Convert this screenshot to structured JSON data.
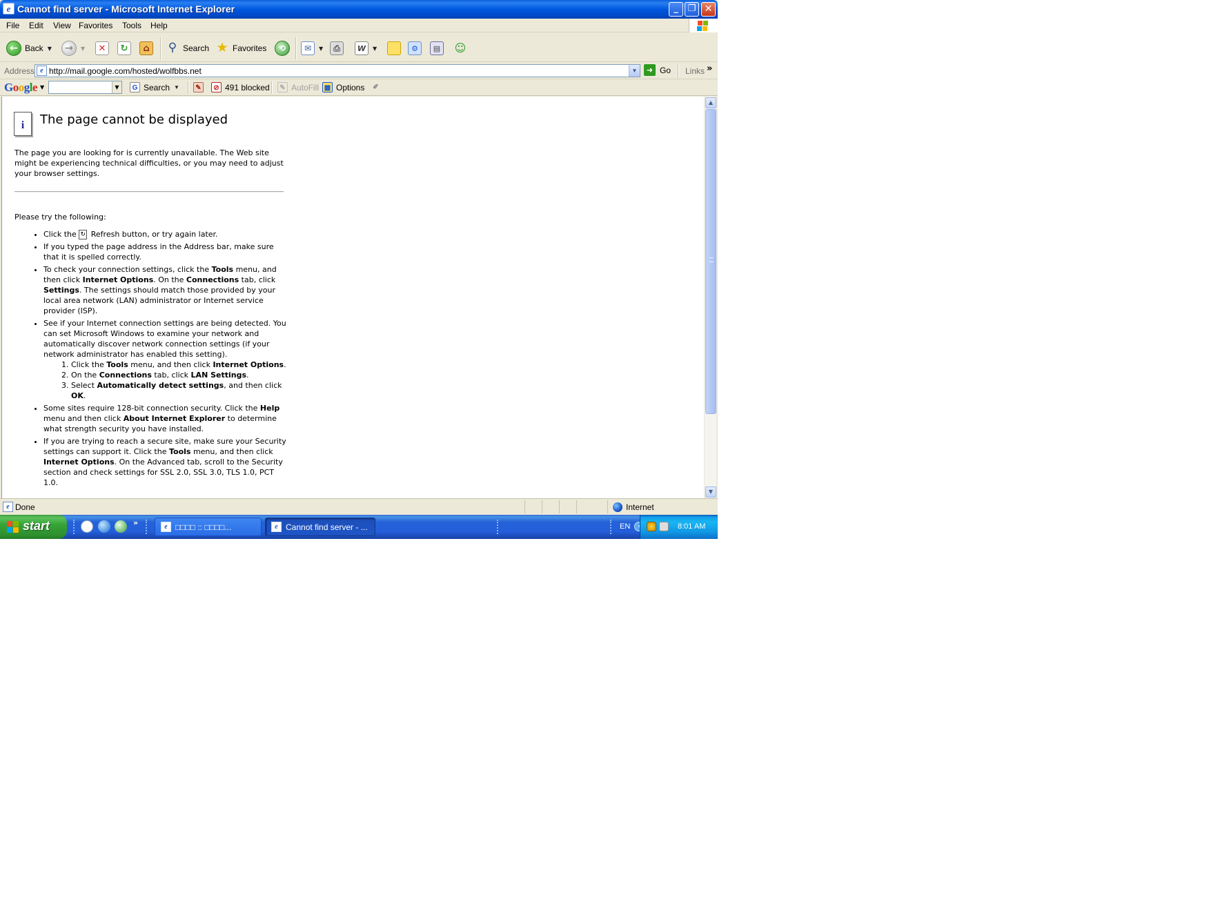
{
  "window": {
    "title": "Cannot find server - Microsoft Internet Explorer"
  },
  "menu": {
    "items": [
      "File",
      "Edit",
      "View",
      "Favorites",
      "Tools",
      "Help"
    ]
  },
  "toolbar": {
    "back_label": "Back",
    "search_label": "Search",
    "favorites_label": "Favorites"
  },
  "address": {
    "label": "Address",
    "url": "http://mail.google.com/hosted/wolfbbs.net",
    "go_label": "Go",
    "links_label": "Links"
  },
  "google_toolbar": {
    "logo": "Google",
    "search_label": "Search",
    "blocked_label": "491 blocked",
    "autofill_label": "AutoFill",
    "options_label": "Options"
  },
  "page": {
    "title": "The page cannot be displayed",
    "description": "The page you are looking for is currently unavailable. The Web site might be experiencing technical difficulties, or you may need to adjust your browser settings.",
    "try_label": "Please try the following:",
    "refresh_before": "Click the ",
    "refresh_after": " Refresh button, or try again later.",
    "typed_address": "If you typed the page address in the Address bar, make sure that it is spelled correctly.",
    "conn_1": "To check your connection settings, click the ",
    "conn_tools": "Tools",
    "conn_2": " menu, and then click ",
    "conn_internet_options": "Internet Options",
    "conn_3": ". On the ",
    "conn_connections": "Connections",
    "conn_4": " tab, click ",
    "conn_settings": "Settings",
    "conn_5": ". The settings should match those provided by your local area network (LAN) administrator or Internet service provider (ISP).",
    "detect_text": "See if your Internet connection settings are being detected. You can set Microsoft Windows to examine your network and automatically discover network connection settings (if your network administrator has enabled this setting).",
    "sub1_1": "Click the ",
    "sub1_tools": "Tools",
    "sub1_2": " menu, and then click ",
    "sub1_options": "Internet Options",
    "sub1_3": ".",
    "sub2_1": "On the ",
    "sub2_connections": "Connections",
    "sub2_2": " tab, click ",
    "sub2_lan": "LAN Settings",
    "sub2_3": ".",
    "sub3_1": "Select ",
    "sub3_auto": "Automatically detect settings",
    "sub3_2": ", and then click ",
    "sub3_ok": "OK",
    "sub3_3": ".",
    "security_1": "Some sites require 128-bit connection security. Click the ",
    "security_help": "Help",
    "security_2": " menu and then click ",
    "security_about": "About Internet Explorer",
    "security_3": " to determine what strength security you have installed.",
    "secure_1": "If you are trying to reach a secure site, make sure your Security settings can support it. Click the ",
    "secure_tools": "Tools",
    "secure_2": " menu, and then click ",
    "secure_options": "Internet Options",
    "secure_3": ". On the Advanced tab, scroll to the Security section and check settings for SSL 2.0, SSL 3.0, TLS 1.0, PCT 1.0."
  },
  "status": {
    "text": "Done",
    "zone": "Internet"
  },
  "taskbar": {
    "start_label": "start",
    "task1_label": "□□□□ :: □□□□...",
    "task2_label": "Cannot find server - ...",
    "language": "EN",
    "time": "8:01 AM"
  }
}
